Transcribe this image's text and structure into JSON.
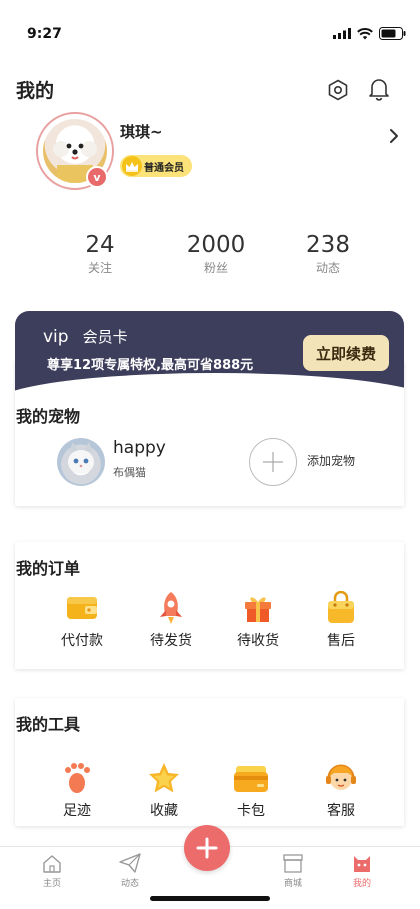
{
  "status": {
    "time": "9:27"
  },
  "header": {
    "title": "我的",
    "settings_icon": "hexagon-settings-icon",
    "bell_icon": "bell-icon"
  },
  "profile": {
    "username": "琪琪~",
    "member_level": "普通会员",
    "verified_badge": "v"
  },
  "stats": [
    {
      "value": "24",
      "label": "关注"
    },
    {
      "value": "2000",
      "label": "粉丝"
    },
    {
      "value": "238",
      "label": "动态"
    }
  ],
  "vip": {
    "title": "vip",
    "subtitle": "会员卡",
    "desc": "尊享12项专属特权,最高可省888元",
    "button": "立即续费",
    "color": "#3d3d5c"
  },
  "pets": {
    "title": "我的宠物",
    "pet_name": "happy",
    "pet_breed": "布偶猫",
    "add_label": "添加宠物"
  },
  "orders": {
    "title": "我的订单",
    "items": [
      {
        "label": "代付款",
        "icon": "wallet-icon"
      },
      {
        "label": "待发货",
        "icon": "rocket-icon"
      },
      {
        "label": "待收货",
        "icon": "gift-icon"
      },
      {
        "label": "售后",
        "icon": "bag-icon"
      }
    ]
  },
  "tools": {
    "title": "我的工具",
    "items": [
      {
        "label": "足迹",
        "icon": "footprint-icon"
      },
      {
        "label": "收藏",
        "icon": "star-icon"
      },
      {
        "label": "卡包",
        "icon": "card-wallet-icon"
      },
      {
        "label": "客服",
        "icon": "service-icon"
      }
    ]
  },
  "tabbar": {
    "items": [
      {
        "label": "主页",
        "icon": "home-icon"
      },
      {
        "label": "动态",
        "icon": "paper-plane-icon"
      },
      {
        "label": "商城",
        "icon": "shop-icon"
      },
      {
        "label": "我的",
        "icon": "cat-icon"
      }
    ],
    "accent": "#ec6b6b"
  }
}
